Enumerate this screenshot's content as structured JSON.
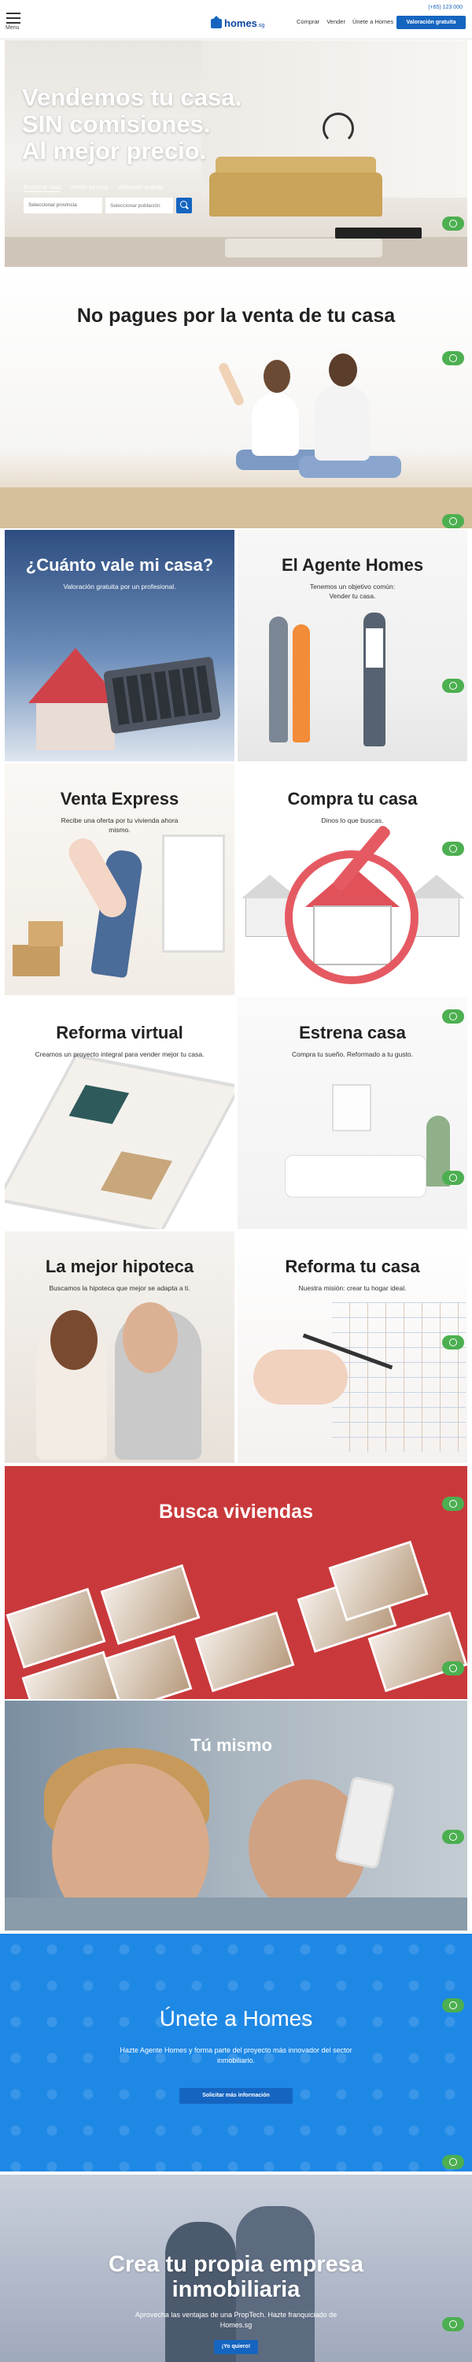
{
  "header": {
    "menu_label": "Menu",
    "logo_text": "homes",
    "logo_suffix": ".sg",
    "phone": "(+65) 123 000",
    "nav": [
      "Comprar",
      "Vender",
      "Únete a Homes"
    ],
    "cta": "Valoración gratuita"
  },
  "hero": {
    "headline": [
      "Vendemos tu casa.",
      "SIN comisiones.",
      "Al mejor precio."
    ],
    "tabs": [
      "Encontrar casa",
      "Vender mi casa",
      "Valoración gratuita"
    ],
    "select_value": "Seleccionar provincia",
    "input_placeholder": "Seleccionar población"
  },
  "no_pagues": {
    "title": "No pagues por la venta de tu casa"
  },
  "cards": [
    {
      "title": "¿Cuánto vale mi casa?",
      "text": "Valoración gratuita por un profesional."
    },
    {
      "title": "El Agente Homes",
      "text": "Tenemos un objetivo común: Vender tu casa."
    },
    {
      "title": "Venta Express",
      "text": "Recibe una oferta por tu vivienda ahora mismo."
    },
    {
      "title": "Compra tu casa",
      "text": "Dinos lo que buscas."
    },
    {
      "title": "Reforma virtual",
      "text": "Creamos un proyecto integral para vender mejor tu casa."
    },
    {
      "title": "Estrena casa",
      "text": "Compra tu sueño. Reformado a tu gusto."
    },
    {
      "title": "La mejor hipoteca",
      "text": "Buscamos la hipoteca que mejor se adapta a ti."
    },
    {
      "title": "Reforma tu casa",
      "text": "Nuestra misión: crear tu hogar ideal."
    }
  ],
  "busca": {
    "title": "Busca viviendas"
  },
  "tu_mismo": {
    "title": "Tú mismo"
  },
  "unete": {
    "title": "Únete a Homes",
    "text": "Hazte Agente Homes y forma parte del proyecto más innovador del sector inmobiliario.",
    "button": "Solicitar más información"
  },
  "crea": {
    "title": [
      "Crea tu propia empresa",
      "inmobiliaria"
    ],
    "text": "Aprovecha las ventajas de una PropTech. Hazte franquiciado de Homes.sg",
    "button": "¡Yo quiero!"
  },
  "colors": {
    "primary": "#1565c0",
    "whatsapp": "#4caf50",
    "busca_bg": "#c9393b",
    "unete_bg": "#1e88e5"
  },
  "icons": {
    "whatsapp": "whatsapp-icon",
    "search": "search-icon",
    "menu": "hamburger-icon"
  }
}
